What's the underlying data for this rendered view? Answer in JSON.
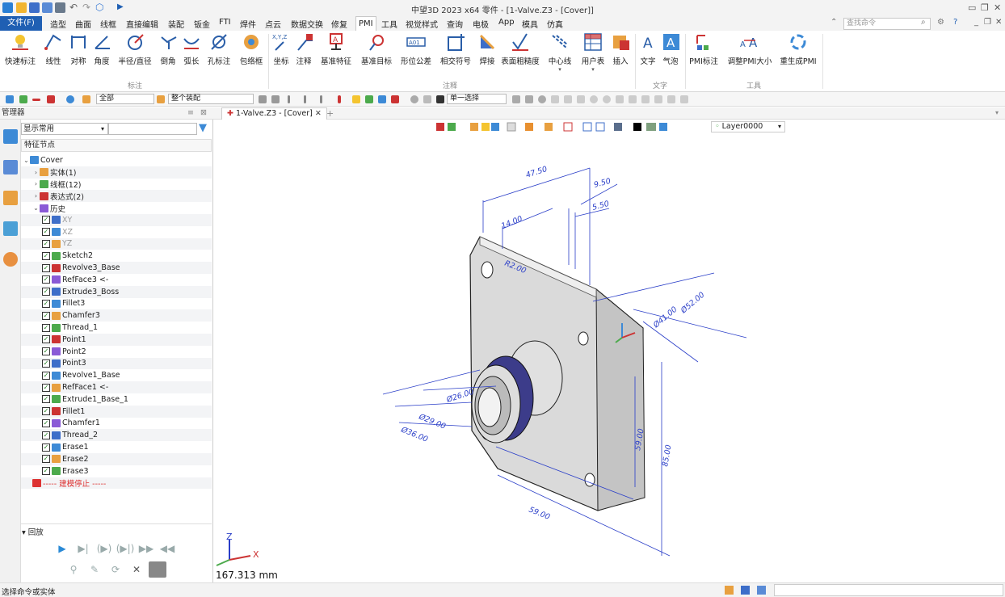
{
  "titlebar": {
    "title": "中望3D 2023 x64      零件 - [1-Valve.Z3 - [Cover]]"
  },
  "menubar": {
    "file": "文件(F)",
    "items": [
      "造型",
      "曲面",
      "线框",
      "直接编辑",
      "装配",
      "钣金",
      "FTI",
      "焊件",
      "点云",
      "数据交换",
      "修复",
      "PMI",
      "工具",
      "视觉样式",
      "查询",
      "电极",
      "App",
      "模具",
      "仿真"
    ],
    "search_placeholder": "查找命令"
  },
  "ribbon": {
    "buttons": [
      "快速标注",
      "线性",
      "对称",
      "角度",
      "半径/直径",
      "倒角",
      "弧长",
      "孔标注",
      "包络框",
      "坐标",
      "注释",
      "基准特征",
      "基准目标",
      "形位公差",
      "相交符号",
      "焊接",
      "表面粗糙度",
      "中心线",
      "用户表",
      "插入",
      "文字",
      "气泡",
      "PMI标注",
      "调整PMI大小",
      "重生成PMI"
    ],
    "groups": [
      "标注",
      "注释",
      "文字",
      "工具"
    ]
  },
  "toolbar2": {
    "filter": "全部",
    "assembly": "整个装配",
    "select_mode": "单一选择"
  },
  "manager": {
    "title": "管理器",
    "display": "显示常用",
    "column": "特征节点",
    "tree": [
      {
        "label": "Cover",
        "level": 0,
        "exp": "v"
      },
      {
        "label": "实体(1)",
        "level": 1,
        "exp": ">"
      },
      {
        "label": "线框(12)",
        "level": 1,
        "exp": ">"
      },
      {
        "label": "表达式(2)",
        "level": 1,
        "exp": ">"
      },
      {
        "label": "历史",
        "level": 1,
        "exp": "v"
      },
      {
        "label": "XY",
        "level": 2,
        "cb": true,
        "grey": true
      },
      {
        "label": "XZ",
        "level": 2,
        "cb": true,
        "grey": true
      },
      {
        "label": "YZ",
        "level": 2,
        "cb": true,
        "grey": true
      },
      {
        "label": "Sketch2",
        "level": 2,
        "cb": true
      },
      {
        "label": "Revolve3_Base",
        "level": 2,
        "cb": true
      },
      {
        "label": "RefFace3 <-",
        "level": 2,
        "cb": true
      },
      {
        "label": "Extrude3_Boss",
        "level": 2,
        "cb": true
      },
      {
        "label": "Fillet3",
        "level": 2,
        "cb": true
      },
      {
        "label": "Chamfer3",
        "level": 2,
        "cb": true
      },
      {
        "label": "Thread_1",
        "level": 2,
        "cb": true
      },
      {
        "label": "Point1",
        "level": 2,
        "cb": true
      },
      {
        "label": "Point2",
        "level": 2,
        "cb": true
      },
      {
        "label": "Point3",
        "level": 2,
        "cb": true
      },
      {
        "label": "Revolve1_Base",
        "level": 2,
        "cb": true
      },
      {
        "label": "RefFace1 <-",
        "level": 2,
        "cb": true
      },
      {
        "label": "Extrude1_Base_1",
        "level": 2,
        "cb": true
      },
      {
        "label": "Fillet1",
        "level": 2,
        "cb": true
      },
      {
        "label": "Chamfer1",
        "level": 2,
        "cb": true
      },
      {
        "label": "Thread_2",
        "level": 2,
        "cb": true
      },
      {
        "label": "Erase1",
        "level": 2,
        "cb": true
      },
      {
        "label": "Erase2",
        "level": 2,
        "cb": true
      },
      {
        "label": "Erase3",
        "level": 2,
        "cb": true
      },
      {
        "label": "----- 建模停止 -----",
        "level": 1,
        "stop": true
      }
    ],
    "playback": "回放"
  },
  "doc": {
    "tab": "1-Valve.Z3 - [Cover]",
    "layer": "Layer0000"
  },
  "view": {
    "scale": "167.313 mm",
    "axis_z": "Z",
    "axis_x": "X",
    "dims": [
      "47.50",
      "9.50",
      "5.50",
      "14.00",
      "R2.00",
      "Ø52.00",
      "Ø41.00",
      "59.00",
      "85.00",
      "59.00",
      "Ø29.00",
      "Ø26.00",
      "Ø36.00"
    ]
  },
  "status": {
    "text": "选择命令或实体"
  }
}
